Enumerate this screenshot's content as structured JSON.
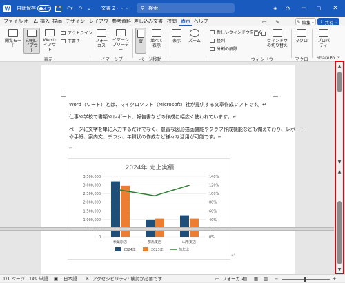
{
  "title_bar": {
    "autosave_label": "自動保存",
    "autosave_state": "オフ",
    "doc_name": "文書 2",
    "doc_status": "・・・",
    "search_placeholder": "検索",
    "brand_color": "#185abd"
  },
  "menu": {
    "tabs": [
      "ファイル",
      "ホーム",
      "挿入",
      "描画",
      "デザイン",
      "レイアウト",
      "参考資料",
      "差し込み文書",
      "校閲",
      "表示",
      "ヘルプ"
    ],
    "active_tab": "表示",
    "edit_label": "編集",
    "share_label": "共有"
  },
  "ribbon": {
    "groups": [
      "表示",
      "イマーシブ",
      "ページ移動",
      "ウィンドウ",
      "マクロ",
      "SharePo"
    ],
    "view_buttons": [
      "閲覧モード",
      "印刷レイアウト",
      "Webレイアウト"
    ],
    "view_small": [
      "アウトライン",
      "下書き"
    ],
    "immersive_buttons": [
      "フォーカス",
      "イマーシブリーダー"
    ],
    "page_buttons": [
      "縦",
      "並べて表示"
    ],
    "display_button": "表示",
    "zoom_button": "ズーム",
    "window_small": [
      "新しいウィンドウを開く",
      "整列",
      "分割の解除"
    ],
    "window_switch": "ウィンドウの切り替え",
    "macro_button": "マクロ",
    "property_button": "プロパティ"
  },
  "document": {
    "paragraphs": [
      "Word（ワード）とは、マイクロソフト（Microsoft）社が提供する文章作成ソフトです。↵",
      "仕事や学校で書類やレポート、報告書などの作成に幅広く使われています。↵",
      "ページに文字を単に入力するだけでなく、豊富な図形描画機能やグラフ作成機能なども備えており、レポート",
      "や手紙、案内文、チラシ、年賀状の作成など様々な活用が可能です。↵"
    ],
    "end_mark": "↵"
  },
  "chart_data": {
    "type": "bar",
    "title": "2024年 売上実績",
    "categories": [
      "秋葉原店",
      "群馬支店",
      "山形支店"
    ],
    "series": [
      {
        "name": "2024年",
        "kind": "bar",
        "color": "#1f4e79",
        "values": [
          3200000,
          1000000,
          1250000
        ]
      },
      {
        "name": "2023年",
        "kind": "bar",
        "color": "#ed7d31",
        "values": [
          2950000,
          1050000,
          1050000
        ]
      },
      {
        "name": "前年比",
        "kind": "line",
        "color": "#2e7d32",
        "axis": "right",
        "values": [
          108,
          95,
          119
        ]
      }
    ],
    "y_ticks": [
      "3,500,000",
      "3,000,000",
      "2,500,000",
      "2,000,000",
      "1,500,000",
      "1,000,000",
      "500,000",
      "0"
    ],
    "y2_ticks": [
      "140%",
      "120%",
      "100%",
      "80%",
      "60%",
      "40%",
      "20%",
      "0%"
    ],
    "ylim": [
      0,
      3500000
    ],
    "y2lim": [
      0,
      140
    ],
    "grid": true,
    "legend_position": "bottom"
  },
  "status_bar": {
    "page": "1/1 ページ",
    "words": "149 単語",
    "language": "日本語",
    "accessibility": "アクセシビリティ: 検討が必要です",
    "focus": "フォーカス",
    "zoom_minus": "−",
    "zoom_plus": "+"
  }
}
